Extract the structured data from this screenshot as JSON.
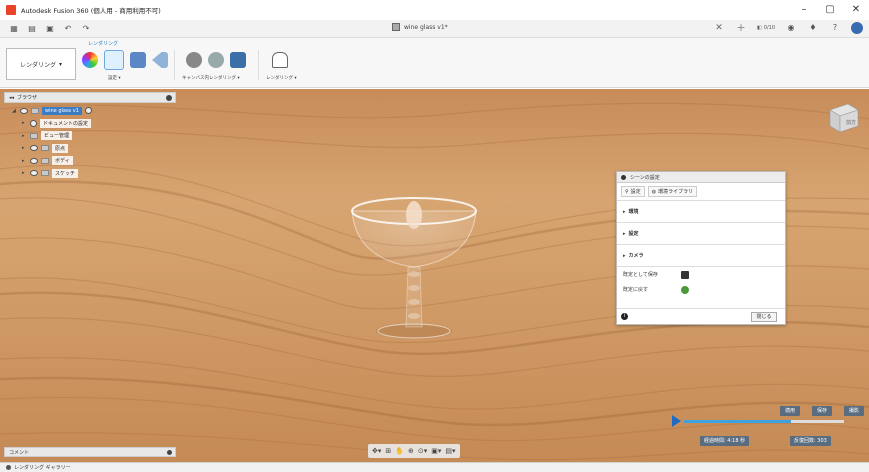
{
  "window": {
    "title": "Autodesk Fusion 360 (個人用 - 商用利用不可)",
    "minimize": "–",
    "maximize": "▢",
    "close": "✕"
  },
  "qat": {
    "document_tab": "wine glass v1*",
    "tab_close": "✕",
    "new_tab": "+",
    "time": "0/10",
    "icons": [
      "grid-menu-icon",
      "file-icon",
      "save-icon",
      "undo-icon",
      "redo-icon"
    ]
  },
  "ribbon": {
    "tab_name": "レンダリング",
    "workspace": "レンダリング",
    "settings_label": "設定 ▾",
    "canvas_render_label": "キャンバス内レンダリング ▾",
    "render_label": "レンダリング ▾"
  },
  "browser": {
    "title": "ブラウザ",
    "items": [
      {
        "label": "wine glass v1",
        "root": true
      },
      {
        "label": "ドキュメントの設定"
      },
      {
        "label": "ビュー管理"
      },
      {
        "label": "原点"
      },
      {
        "label": "ボディ"
      },
      {
        "label": "スケッチ"
      }
    ]
  },
  "comments": {
    "label": "コメント"
  },
  "statusbar": {
    "label": "レンダリング ギャラリー"
  },
  "viewcube": {
    "face_label": "前方"
  },
  "scene": {
    "title": "シーンの設定",
    "tab_settings": "設定",
    "tab_library": "環境ライブラリ",
    "sections": [
      "環境",
      "設定",
      "カメラ"
    ],
    "save_default": "既定として保存",
    "restore_default": "既定に戻す",
    "close_button": "閉じる"
  },
  "render": {
    "btn1": "適用",
    "btn2": "保存",
    "btn3": "撮影",
    "elapsed": "経過時間: 4:18 秒",
    "progress": 0.67,
    "iterations": "反復回数: 303"
  },
  "colors": {
    "accent": "#2d7fc7",
    "wood": "#d49a64"
  }
}
